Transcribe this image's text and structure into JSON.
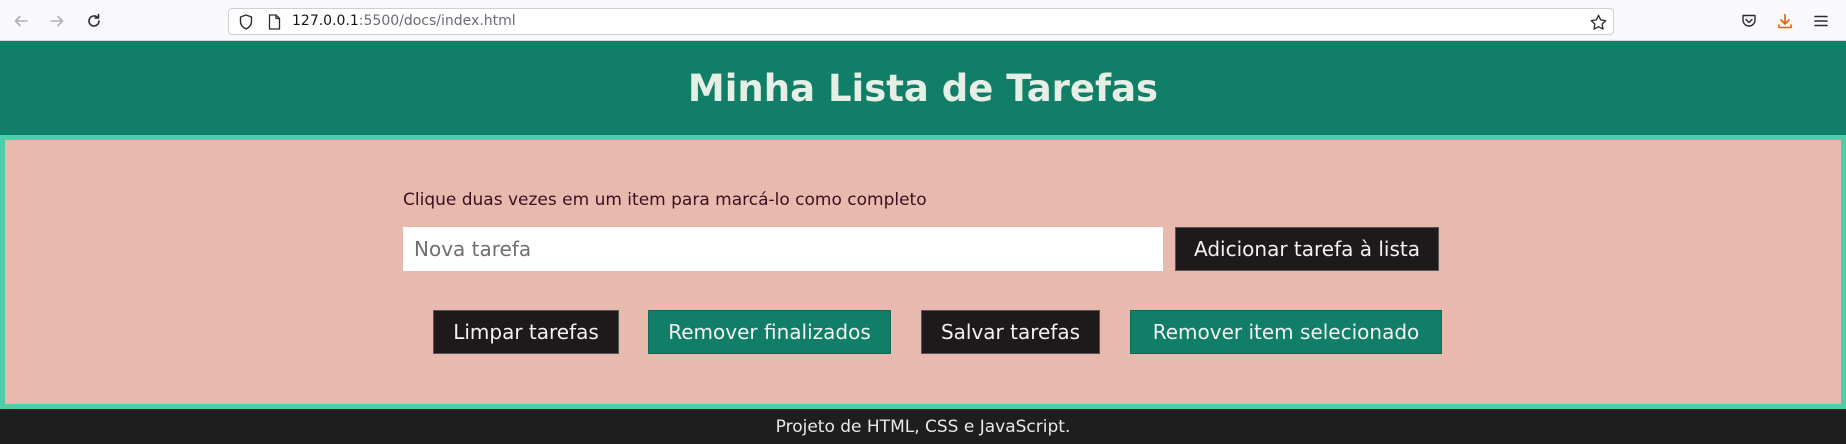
{
  "browser": {
    "url_host": "127.0.0.1",
    "url_rest": ":5500/docs/index.html"
  },
  "header": {
    "title": "Minha Lista de Tarefas"
  },
  "main": {
    "hint": "Clique duas vezes em um item para marcá-lo como completo",
    "task_input_placeholder": "Nova tarefa",
    "task_input_value": "",
    "add_button": "Adicionar tarefa à lista",
    "actions": {
      "clear": "Limpar tarefas",
      "remove_finished": "Remover finalizados",
      "save": "Salvar tarefas",
      "remove_selected": "Remover item selecionado"
    }
  },
  "footer": {
    "text": "Projeto de HTML, CSS e JavaScript."
  },
  "colors": {
    "header_bg": "#117f68",
    "main_bg": "#e8b9ae",
    "main_border": "#4dcda9",
    "dark_button": "#1e1a1b",
    "green_button": "#117f68",
    "footer_bg": "#1e1e1e"
  }
}
